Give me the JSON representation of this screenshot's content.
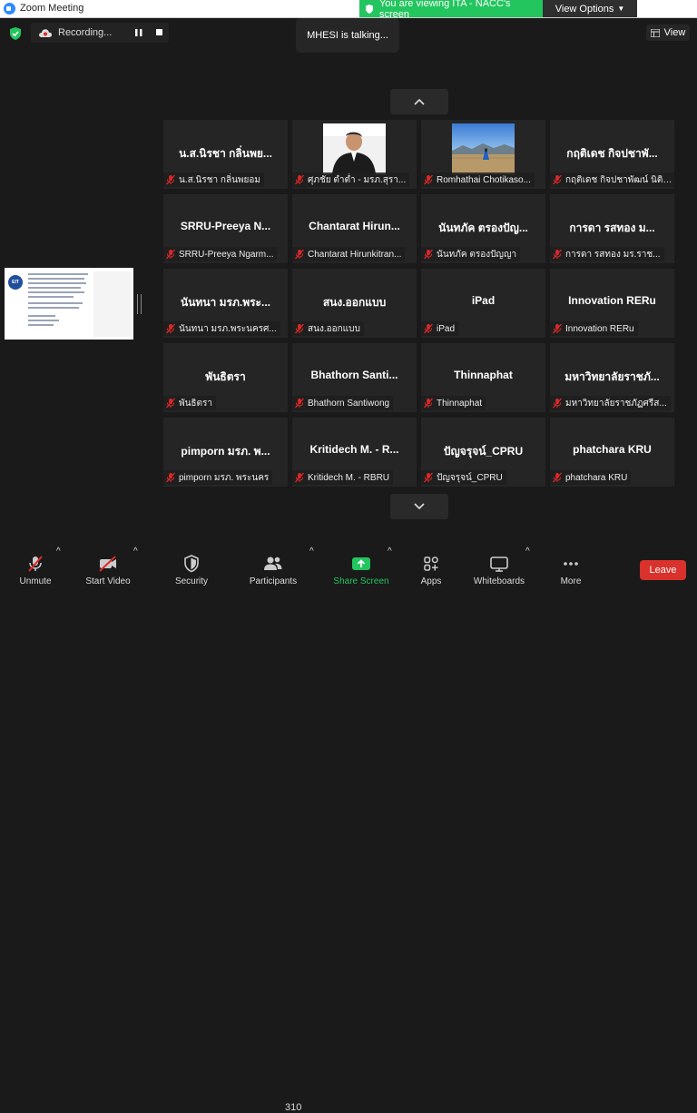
{
  "window": {
    "title": "Zoom Meeting"
  },
  "share_banner": {
    "text": "You are viewing ITA - NACC's screen",
    "view_options": "View Options"
  },
  "recording": {
    "label": "Recording..."
  },
  "talking": {
    "text": "MHESI is talking..."
  },
  "view": {
    "label": "View"
  },
  "tiles": [
    {
      "big": "น.ส.นิรชา กลิ่นพย...",
      "name": "น.ส.นิรชา กลิ่นพยอม"
    },
    {
      "big": "",
      "name": "ศุภชัย ตำต่ำ - มรภ.สุรา..."
    },
    {
      "big": "",
      "name": "Romhathai Chotikaso..."
    },
    {
      "big": "กฤติเดช กิจปชาพั...",
      "name": "กฤติเดช กิจปชาพัฒน์ นิติกร"
    },
    {
      "big": "SRRU-Preeya N...",
      "name": "SRRU-Preeya Ngarm..."
    },
    {
      "big": "Chantarat Hirun...",
      "name": "Chantarat Hirunkitran..."
    },
    {
      "big": "นันทภัค ตรองปัญ...",
      "name": "นันทภัค ตรองปัญญา"
    },
    {
      "big": "การดา รสทอง ม...",
      "name": "การดา รสทอง มร.ราช..."
    },
    {
      "big": "นันทนา มรภ.พระ...",
      "name": "นันทนา มรภ.พระนครศ..."
    },
    {
      "big": "สนง.ออกแบบ",
      "name": "สนง.ออกแบบ"
    },
    {
      "big": "iPad",
      "name": "iPad"
    },
    {
      "big": "Innovation RERu",
      "name": "Innovation RERu"
    },
    {
      "big": "พันธิตรา",
      "name": "พันธิตรา"
    },
    {
      "big": "Bhathorn Santi...",
      "name": "Bhathorn Santiwong"
    },
    {
      "big": "Thinnaphat",
      "name": "Thinnaphat"
    },
    {
      "big": "มหาวิทยาลัยราชภั...",
      "name": "มหาวิทยาลัยราชภัฏศรีส..."
    },
    {
      "big": "pimporn มรภ. พ...",
      "name": "pimporn มรภ. พระนคร"
    },
    {
      "big": "Kritidech M. - R...",
      "name": "Kritidech M. - RBRU"
    },
    {
      "big": "ปัญจรุจน์_CPRU",
      "name": "ปัญจรุจน์_CPRU"
    },
    {
      "big": "phatchara KRU",
      "name": "phatchara KRU"
    }
  ],
  "shared_thumb": {
    "logo": "EIT"
  },
  "toolbar": {
    "unmute": "Unmute",
    "start_video": "Start Video",
    "security": "Security",
    "participants": "Participants",
    "participant_count": "310",
    "share_screen": "Share Screen",
    "apps": "Apps",
    "whiteboards": "Whiteboards",
    "more": "More",
    "leave": "Leave"
  },
  "colors": {
    "share_green": "#23c55e",
    "leave_red": "#d9312b",
    "mute_red": "#e02828"
  }
}
